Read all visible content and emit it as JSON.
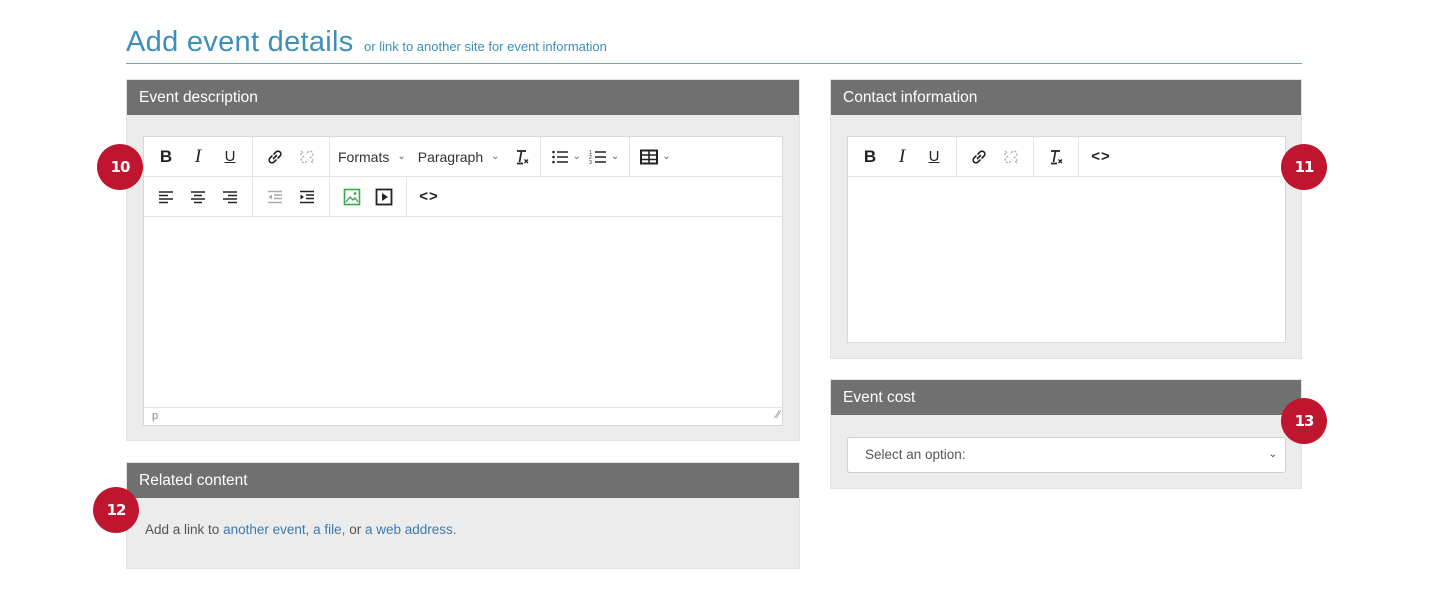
{
  "header": {
    "title": "Add event details",
    "subtitle": "or link to another site for event information"
  },
  "description_panel": {
    "title": "Event description",
    "toolbar": {
      "bold": "B",
      "italic": "I",
      "underline": "U",
      "formats_label": "Formats",
      "paragraph_label": "Paragraph",
      "code": "<>"
    },
    "status_path": "p"
  },
  "contact_panel": {
    "title": "Contact information",
    "toolbar": {
      "bold": "B",
      "italic": "I",
      "underline": "U",
      "code": "<>"
    }
  },
  "related_panel": {
    "title": "Related content",
    "prefix": "Add a link to",
    "link_event": "another event,",
    "link_file": "a file,",
    "or": "or",
    "link_web": "a web address."
  },
  "cost_panel": {
    "title": "Event cost",
    "select_value": "Select an option:"
  },
  "badges": {
    "b10": "10",
    "b11": "11",
    "b12": "12",
    "b13": "13"
  },
  "colors": {
    "accent": "#3c8fb8",
    "panel_header": "#707070",
    "badge": "#c0152f",
    "link": "#3c7bb0"
  }
}
